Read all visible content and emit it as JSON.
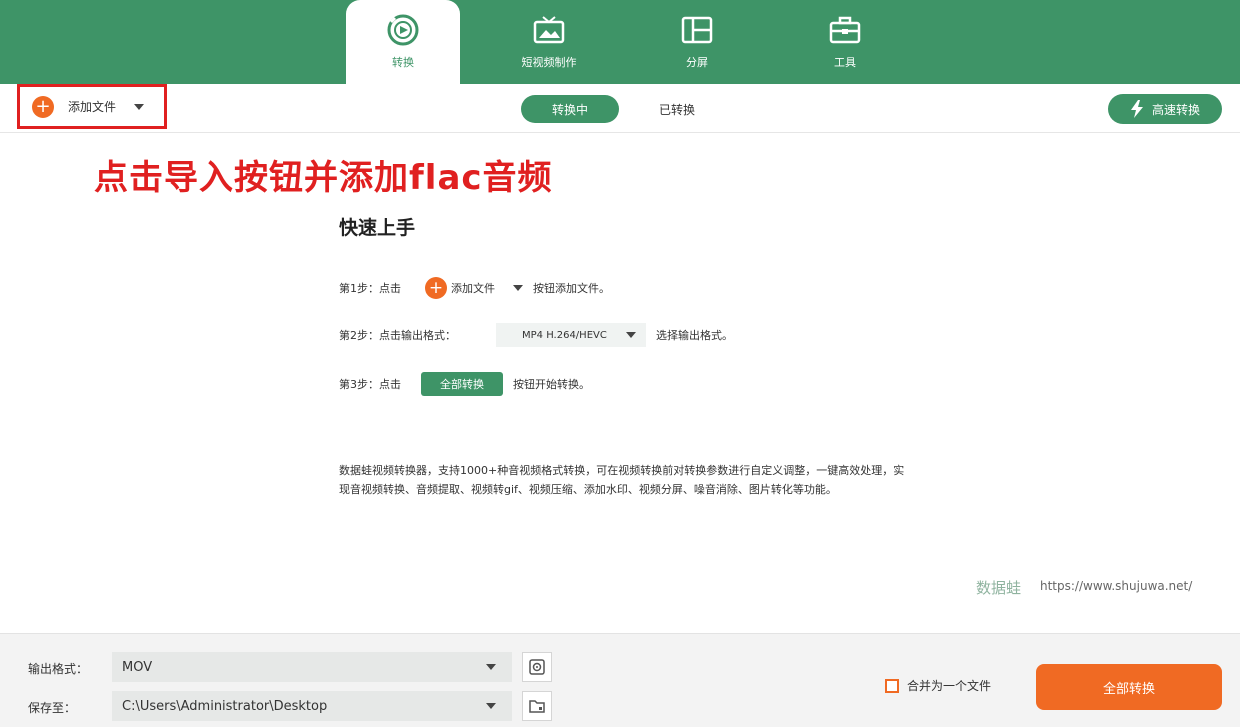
{
  "tabs": [
    {
      "label": "转换",
      "icon": "convert-icon",
      "active": true
    },
    {
      "label": "短视频制作",
      "icon": "tv-icon",
      "active": false
    },
    {
      "label": "分屏",
      "icon": "split-screen-icon",
      "active": false
    },
    {
      "label": "工具",
      "icon": "toolbox-icon",
      "active": false
    }
  ],
  "toolbar": {
    "add_file_label": "添加文件",
    "converting_label": "转换中",
    "converted_label": "已转换",
    "fast_convert_label": "高速转换"
  },
  "annotation": "点击导入按钮并添加flac音频",
  "quickstart": {
    "title": "快速上手",
    "step1_prefix": "第1步：点击",
    "step1_button": "添加文件",
    "step1_suffix": "按钮添加文件。",
    "step2_prefix": "第2步：点击输出格式：",
    "step2_select": "MP4 H.264/HEVC",
    "step2_suffix": "选择输出格式。",
    "step3_prefix": "第3步：点击",
    "step3_button": "全部转换",
    "step3_suffix": "按钮开始转换。"
  },
  "description": "数据蛙视频转换器，支持1000+种音视频格式转换，可在视频转换前对转换参数进行自定义调整，一键高效处理，实现音视频转换、音频提取、视频转gif、视频压缩、添加水印、视频分屏、噪音消除、图片转化等功能。",
  "brand": {
    "name": "数据蛙",
    "url": "https://www.shujuwa.net/"
  },
  "bottom": {
    "output_format_label": "输出格式：",
    "output_format_value": "MOV",
    "save_to_label": "保存至：",
    "save_path": "C:\\Users\\Administrator\\Desktop",
    "merge_label": "合并为一个文件",
    "merge_checked": false,
    "convert_all_label": "全部转换"
  },
  "colors": {
    "primary": "#3e9467",
    "accent": "#f06a23",
    "annotation": "#e02020"
  }
}
